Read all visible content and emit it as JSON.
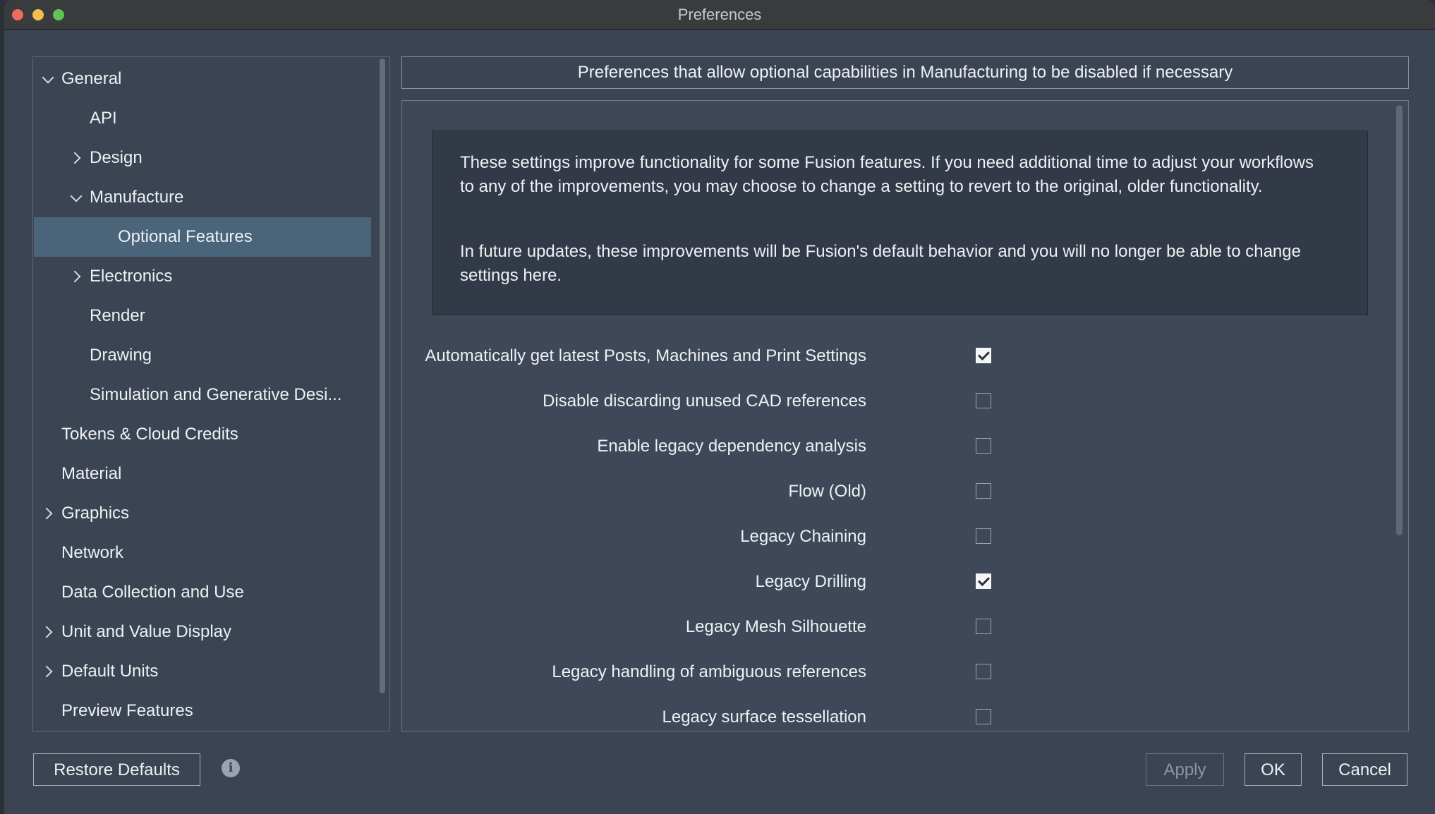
{
  "window": {
    "title": "Preferences"
  },
  "sidebar": {
    "items": [
      {
        "label": "General",
        "chevron": "down"
      },
      {
        "label": "API"
      },
      {
        "label": "Design",
        "chevron": "right"
      },
      {
        "label": "Manufacture",
        "chevron": "down"
      },
      {
        "label": "Optional Features",
        "selected": true
      },
      {
        "label": "Electronics",
        "chevron": "right"
      },
      {
        "label": "Render"
      },
      {
        "label": "Drawing"
      },
      {
        "label": "Simulation and Generative Desi..."
      },
      {
        "label": "Tokens & Cloud Credits"
      },
      {
        "label": "Material"
      },
      {
        "label": "Graphics",
        "chevron": "right"
      },
      {
        "label": "Network"
      },
      {
        "label": "Data Collection and Use"
      },
      {
        "label": "Unit and Value Display",
        "chevron": "right"
      },
      {
        "label": "Default Units",
        "chevron": "right"
      },
      {
        "label": "Preview Features"
      }
    ]
  },
  "header": {
    "text": "Preferences that allow optional capabilities in Manufacturing to be disabled if necessary"
  },
  "info": {
    "paragraph1": "These settings improve functionality for some Fusion features. If you need additional time to adjust your workflows to any of the improvements, you may choose to change a setting to revert to the original, older functionality.",
    "paragraph2": "In future updates, these improvements will be Fusion's default behavior and you will no longer be able to change settings here."
  },
  "options": [
    {
      "label": "Automatically get latest Posts, Machines and Print Settings",
      "checked": true
    },
    {
      "label": "Disable discarding unused CAD references",
      "checked": false
    },
    {
      "label": "Enable legacy dependency analysis",
      "checked": false
    },
    {
      "label": "Flow (Old)",
      "checked": false
    },
    {
      "label": "Legacy Chaining",
      "checked": false
    },
    {
      "label": "Legacy Drilling",
      "checked": true
    },
    {
      "label": "Legacy Mesh Silhouette",
      "checked": false
    },
    {
      "label": "Legacy handling of ambiguous references",
      "checked": false
    },
    {
      "label": "Legacy surface tessellation",
      "checked": false
    }
  ],
  "footer": {
    "restore_label": "Restore Defaults",
    "info_icon": "info-icon",
    "apply_label": "Apply",
    "apply_enabled": false,
    "ok_label": "OK",
    "cancel_label": "Cancel"
  }
}
